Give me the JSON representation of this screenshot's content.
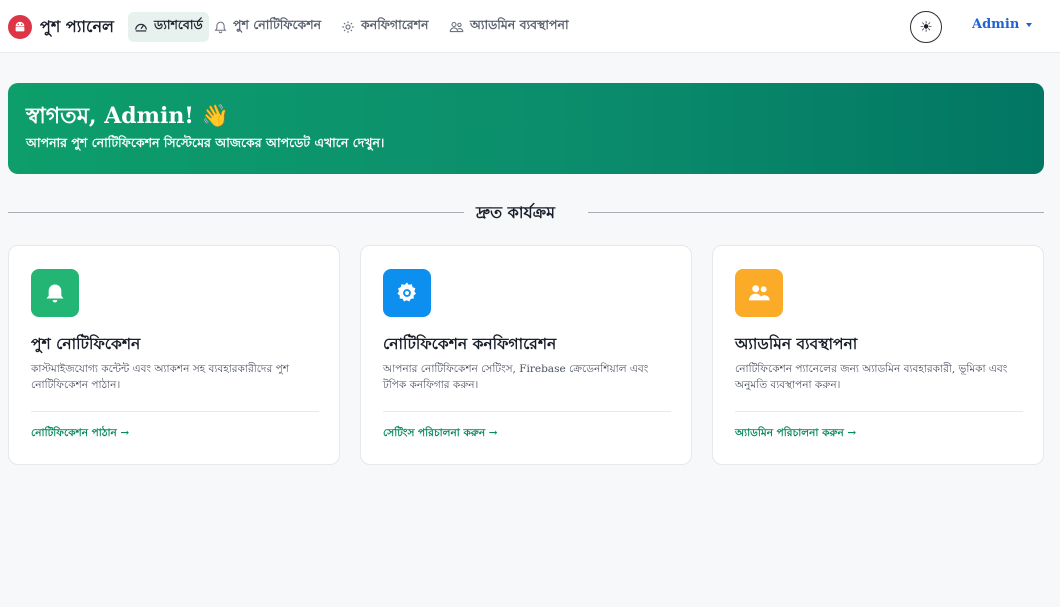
{
  "brand": {
    "title": "পুশ প্যানেল",
    "logo_icon": "android-icon"
  },
  "nav": [
    {
      "label": "ড্যাশবোর্ড",
      "icon": "speedometer-icon",
      "active": true
    },
    {
      "label": "পুশ নোটিফিকেশন",
      "icon": "bell-icon",
      "active": false
    },
    {
      "label": "কনফিগারেশন",
      "icon": "gear-icon",
      "active": false
    },
    {
      "label": "অ্যাডমিন ব্যবস্থাপনা",
      "icon": "people-icon",
      "active": false
    }
  ],
  "theme_toggle": {
    "icon": "sun-icon",
    "glyph": "☀"
  },
  "user_menu": {
    "label": "Admin"
  },
  "hero": {
    "title": "স্বাগতম, Admin! 👋",
    "subtitle": "আপনার পুশ নোটিফিকেশন সিস্টেমের আজকের আপডেট এখানে দেখুন।"
  },
  "section": {
    "title": "দ্রুত কার্যক্রম"
  },
  "cards": [
    {
      "title": "পুশ নোটিফিকেশন",
      "description": "কাস্টমাইজযোগ্য কন্টেন্ট এবং অ্যাকশন সহ ব্যবহারকারীদের পুশ নোটিফিকেশন পাঠান।",
      "link": "নোটিফিকেশন পাঠান →",
      "icon": "bell-icon",
      "color": "#22b573"
    },
    {
      "title": "নোটিফিকেশন কনফিগারেশন",
      "description": "আপনার নোটিফিকেশন সেটিংস, Firebase ক্রেডেনশিয়াল এবং টপিক কনফিগার করুন।",
      "link": "সেটিংস পরিচালনা করুন →",
      "icon": "gear-icon",
      "color": "#0d8ff0"
    },
    {
      "title": "অ্যাডমিন ব্যবস্থাপনা",
      "description": "নোটিফিকেশন প্যানেলের জন্য অ্যাডমিন ব্যবহারকারী, ভূমিকা এবং অনুমতি ব্যবস্থাপনা করুন।",
      "link": "অ্যাডমিন পরিচালনা করুন →",
      "icon": "people-icon",
      "color": "#fbab27"
    }
  ]
}
